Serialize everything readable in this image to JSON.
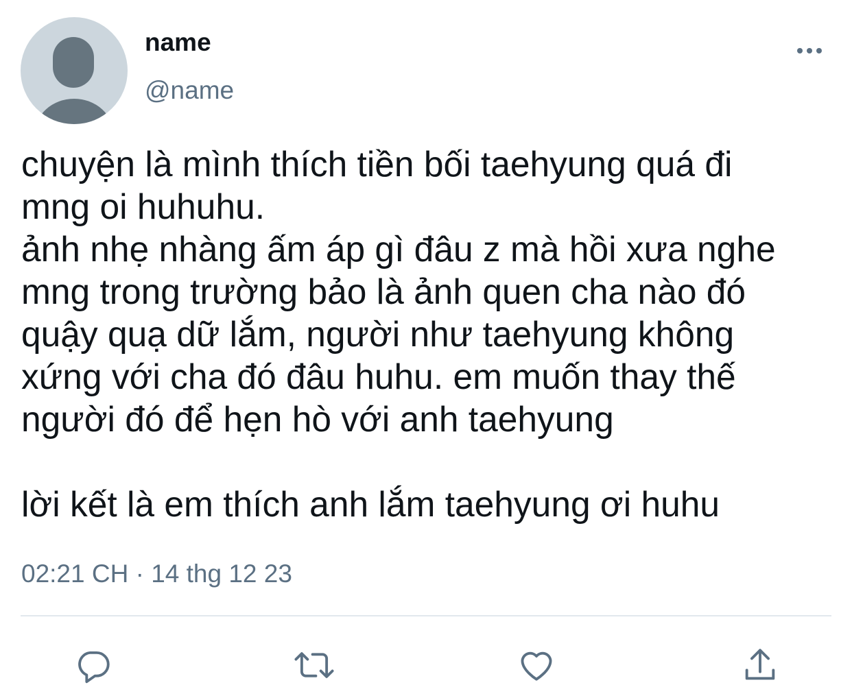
{
  "tweet": {
    "author": {
      "display_name": "name",
      "handle": "@name",
      "avatar_icon": "default-avatar-icon"
    },
    "text": "chuyện là mình thích tiền bối taehyung quá đi\nmng oi huhuhu.\nảnh nhẹ nhàng ấm áp gì đâu z mà hồi xưa nghe\nmng trong trường bảo là ảnh quen cha nào đó\nquậy quạ dữ lắm, người như taehyung không\nxứng với cha đó đâu huhu. em muốn thay thế\nngười đó để hẹn hò với anh taehyung\n\nlời kết là em thích anh lắm taehyung ơi huhu",
    "timestamp": "02:21 CH · 14 thg 12 23"
  },
  "actions": {
    "reply_icon": "reply-icon",
    "retweet_icon": "retweet-icon",
    "like_icon": "like-icon",
    "share_icon": "share-icon",
    "more_icon": "more-icon"
  },
  "colors": {
    "text_primary": "#0f1419",
    "text_secondary": "#5b7083",
    "avatar_bg": "#ccd6dd",
    "avatar_figure": "#66757f",
    "divider": "#e1e8ed",
    "icon": "#5b7083"
  }
}
